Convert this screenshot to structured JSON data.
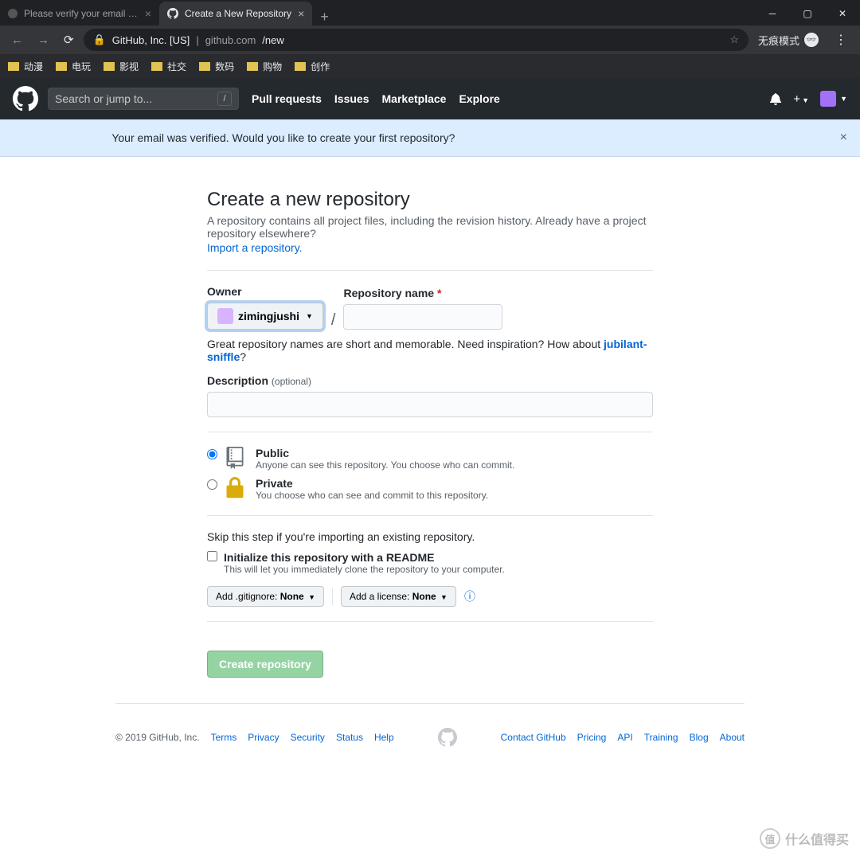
{
  "browser": {
    "tabs": [
      {
        "title": "Please verify your email addre"
      },
      {
        "title": "Create a New Repository"
      }
    ],
    "security_label": "GitHub, Inc. [US]",
    "url_host": "github.com",
    "url_path": "/new",
    "incognito_label": "无痕模式",
    "bookmarks": [
      "动漫",
      "电玩",
      "影视",
      "社交",
      "数码",
      "购物",
      "创作"
    ]
  },
  "header": {
    "search_placeholder": "Search or jump to...",
    "search_key": "/",
    "nav": [
      "Pull requests",
      "Issues",
      "Marketplace",
      "Explore"
    ]
  },
  "flash": {
    "message": "Your email was verified. Would you like to create your first repository?"
  },
  "page": {
    "heading": "Create a new repository",
    "subtext": "A repository contains all project files, including the revision history. Already have a project repository elsewhere?",
    "import_link": "Import a repository.",
    "owner_label": "Owner",
    "owner_value": "zimingjushi",
    "repo_name_label": "Repository name",
    "tip_prefix": "Great repository names are short and memorable. Need inspiration? How about ",
    "tip_suggestion": "jubilant-sniffle",
    "desc_label": "Description",
    "desc_optional": "(optional)",
    "visibility": {
      "public": {
        "title": "Public",
        "desc": "Anyone can see this repository. You choose who can commit."
      },
      "private": {
        "title": "Private",
        "desc": "You choose who can see and commit to this repository."
      }
    },
    "skip_text": "Skip this step if you're importing an existing repository.",
    "readme_label": "Initialize this repository with a README",
    "readme_desc": "This will let you immediately clone the repository to your computer.",
    "gitignore": {
      "label": "Add .gitignore: ",
      "value": "None"
    },
    "license": {
      "label": "Add a license: ",
      "value": "None"
    },
    "submit": "Create repository"
  },
  "footer": {
    "copyright": "© 2019 GitHub, Inc.",
    "left": [
      "Terms",
      "Privacy",
      "Security",
      "Status",
      "Help"
    ],
    "right": [
      "Contact GitHub",
      "Pricing",
      "API",
      "Training",
      "Blog",
      "About"
    ]
  },
  "watermark": "什么值得买"
}
